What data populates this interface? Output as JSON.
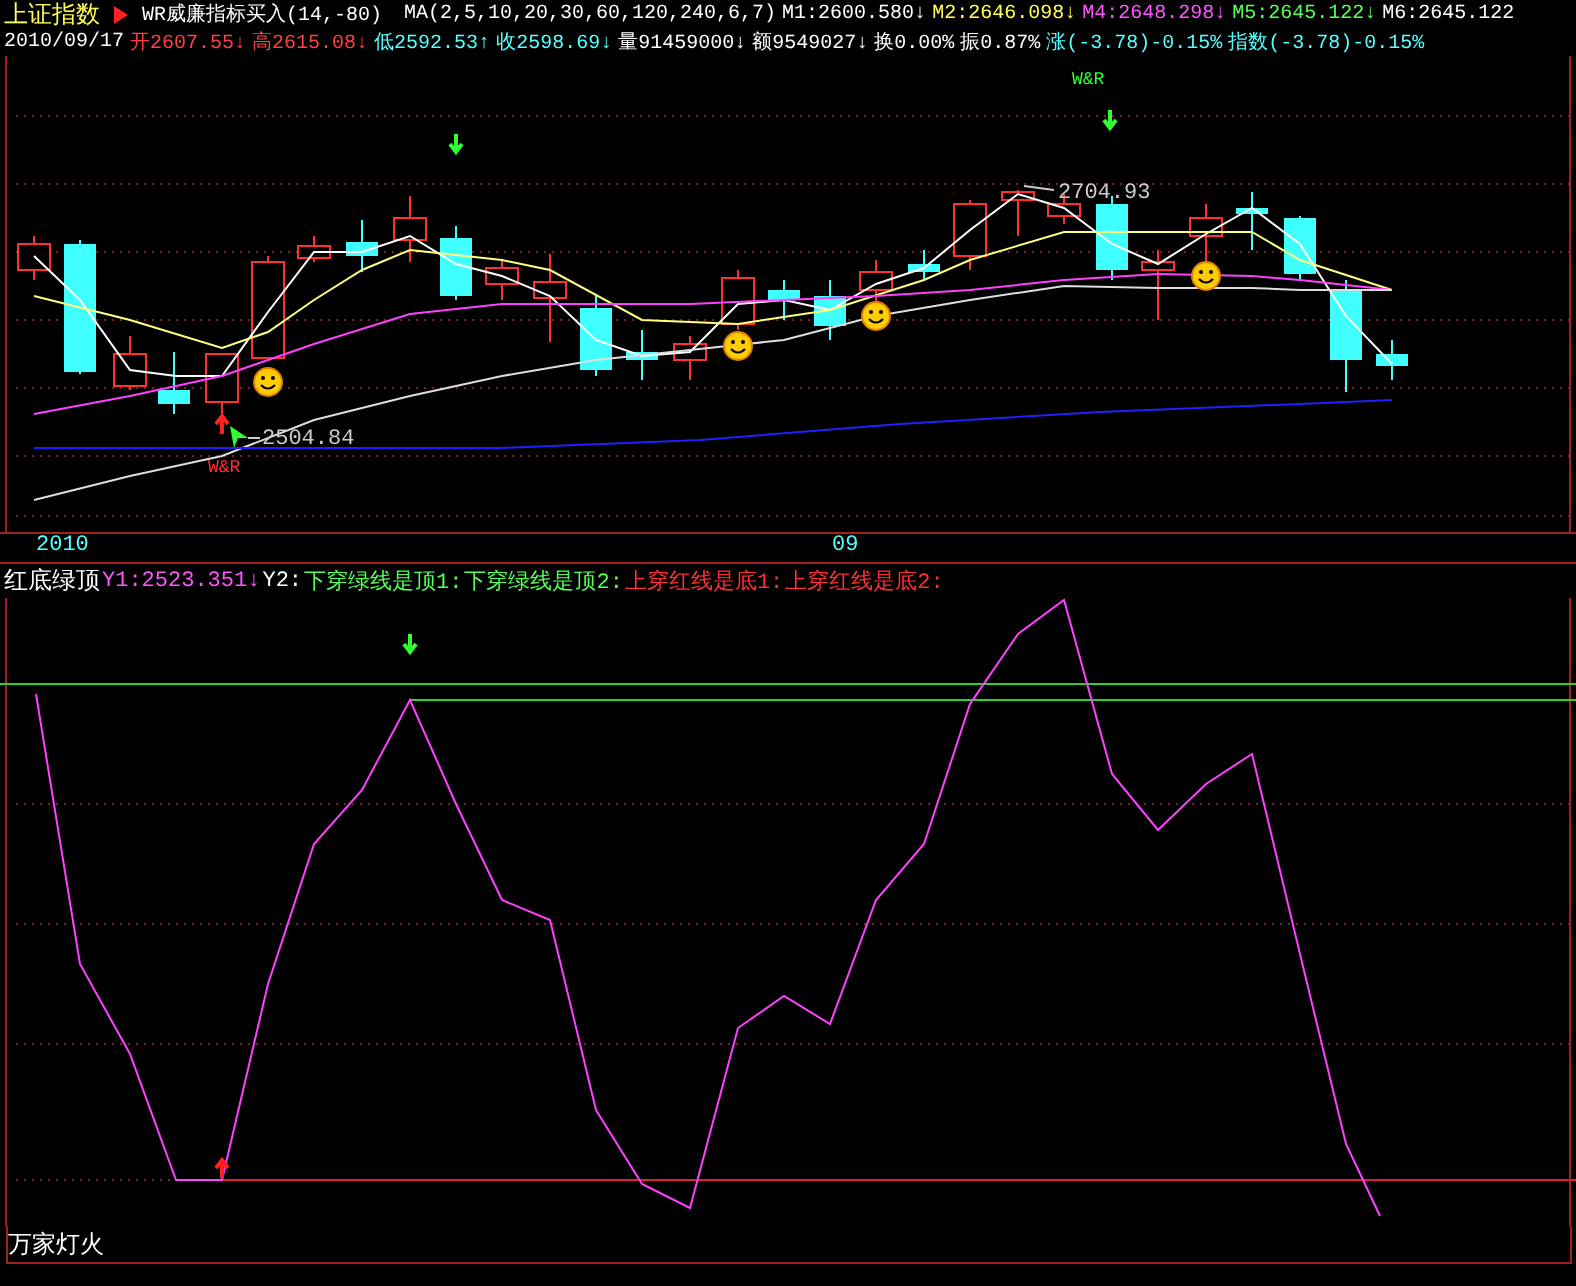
{
  "header": {
    "index_name": "上证指数",
    "indicator_title": "WR威廉指标买入(14,-80)",
    "ma_params": "MA(2,5,10,20,30,60,120,240,6,7)",
    "ma_values": [
      {
        "text": "M1:2600.580↓",
        "color": "#ffffff"
      },
      {
        "text": "M2:2646.098↓",
        "color": "#ffff55"
      },
      {
        "text": "M4:2648.298↓",
        "color": "#ff55ff"
      },
      {
        "text": "M5:2645.122↓",
        "color": "#55ff55"
      },
      {
        "text": "M6:2645.122",
        "color": "#ffffff"
      }
    ],
    "date": "2010/09/17",
    "quotes": [
      {
        "text": "开2607.55↓",
        "color": "#ff4040"
      },
      {
        "text": "高2615.08↓",
        "color": "#ff4040"
      },
      {
        "text": "低2592.53↑",
        "color": "#55ffff"
      },
      {
        "text": "收2598.69↓",
        "color": "#55ffff"
      },
      {
        "text": "量91459000↓",
        "color": "#ffffff"
      },
      {
        "text": "额9549027↓",
        "color": "#ffffff"
      },
      {
        "text": "换0.00%",
        "color": "#ffffff"
      },
      {
        "text": "振0.87%",
        "color": "#ffffff"
      },
      {
        "text": "涨(-3.78)-0.15%",
        "color": "#55ffff"
      },
      {
        "text": "指数(-3.78)-0.15%",
        "color": "#55ffff"
      }
    ]
  },
  "main_chart": {
    "signal_labels": [
      {
        "text": "W&R",
        "color": "#ff3030"
      },
      {
        "text": "W&R",
        "color": "#30ff30"
      }
    ],
    "price_labels": [
      "2504.84",
      "2704.93"
    ]
  },
  "time_axis": [
    "2010",
    "09"
  ],
  "indicator_header": {
    "name": "红底绿顶",
    "values": [
      {
        "text": "Y1:2523.351↓",
        "color": "#ff55ff"
      },
      {
        "text": "Y2:",
        "color": "#ffffff"
      },
      {
        "text": "下穿绿线是顶1:",
        "color": "#55ff55"
      },
      {
        "text": "下穿绿线是顶2:",
        "color": "#55ff55"
      },
      {
        "text": "上穿红线是底1:",
        "color": "#ff3030"
      },
      {
        "text": "上穿红线是底2:",
        "color": "#ff3030"
      }
    ]
  },
  "footer": "万家灯火"
}
